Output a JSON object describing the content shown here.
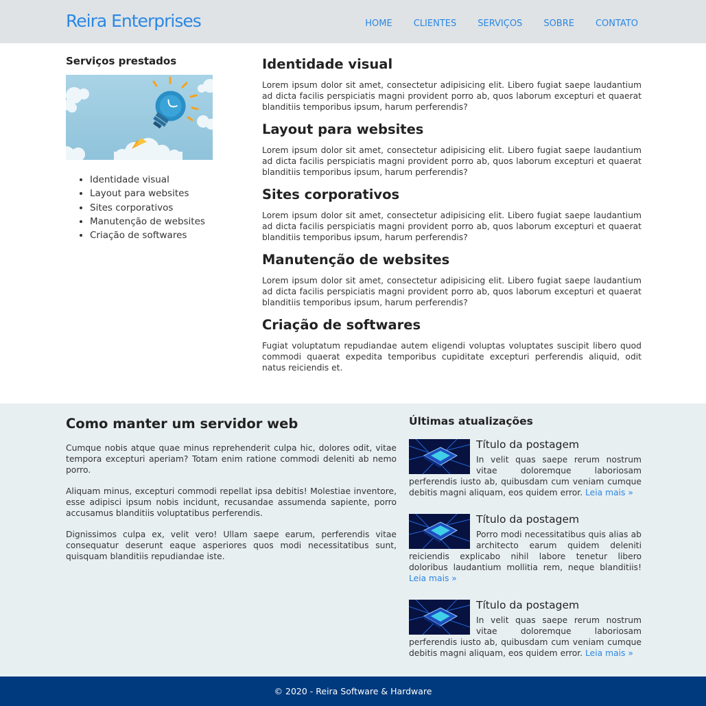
{
  "header": {
    "brand": "Reira Enterprises",
    "nav": [
      "HOME",
      "CLIENTES",
      "SERVIÇOS",
      "SOBRE",
      "CONTATO"
    ]
  },
  "sidebar": {
    "title": "Serviços prestados",
    "items": [
      "Identidade visual",
      "Layout para websites",
      "Sites corporativos",
      "Manutenção de websites",
      "Criação de softwares"
    ]
  },
  "services": [
    {
      "title": "Identidade visual",
      "text": "Lorem ipsum dolor sit amet, consectetur adipisicing elit. Libero fugiat saepe laudantium ad dicta facilis perspiciatis magni provident porro ab, quos laborum excepturi et quaerat blanditiis temporibus ipsum, harum perferendis?"
    },
    {
      "title": "Layout para websites",
      "text": "Lorem ipsum dolor sit amet, consectetur adipisicing elit. Libero fugiat saepe laudantium ad dicta facilis perspiciatis magni provident porro ab, quos laborum excepturi et quaerat blanditiis temporibus ipsum, harum perferendis?"
    },
    {
      "title": "Sites corporativos",
      "text": "Lorem ipsum dolor sit amet, consectetur adipisicing elit. Libero fugiat saepe laudantium ad dicta facilis perspiciatis magni provident porro ab, quos laborum excepturi et quaerat blanditiis temporibus ipsum, harum perferendis?"
    },
    {
      "title": "Manutenção de websites",
      "text": "Lorem ipsum dolor sit amet, consectetur adipisicing elit. Libero fugiat saepe laudantium ad dicta facilis perspiciatis magni provident porro ab, quos laborum excepturi et quaerat blanditiis temporibus ipsum, harum perferendis?"
    },
    {
      "title": "Criação de softwares",
      "text": "Fugiat voluptatum repudiandae autem eligendi voluptas voluptates suscipit libero quod commodi quaerat expedita temporibus cupiditate excepturi perferendis aliquid, odit natus reiciendis et."
    }
  ],
  "article": {
    "title": "Como manter um servidor web",
    "paragraphs": [
      "Cumque nobis atque quae minus reprehenderit culpa hic, dolores odit, vitae tempora excepturi aperiam? Totam enim ratione commodi deleniti ab nemo porro.",
      "Aliquam minus, excepturi commodi repellat ipsa debitis! Molestiae inventore, esse adipisci ipsum nobis incidunt, recusandae assumenda sapiente, porro accusamus blanditiis voluptatibus perferendis.",
      "Dignissimos culpa ex, velit vero! Ullam saepe earum, perferendis vitae consequatur deserunt eaque asperiores quos modi necessitatibus sunt, quisquam blanditiis repudiandae iste."
    ]
  },
  "updates": {
    "title": "Últimas atualizações",
    "posts": [
      {
        "title": "Título da postagem",
        "text": "In velit quas saepe rerum nostrum vitae doloremque laboriosam perferendis iusto ab, quibusdam cum veniam cumque debitis magni aliquam, eos quidem error.",
        "link": "Leia mais »"
      },
      {
        "title": "Título da postagem",
        "text": "Porro modi necessitatibus quis alias ab architecto earum quidem deleniti reiciendis explicabo nihil labore tenetur libero doloribus laudantium mollitia rem, neque blanditiis!",
        "link": "Leia mais »"
      },
      {
        "title": "Título da postagem",
        "text": "In velit quas saepe rerum nostrum vitae doloremque laboriosam perferendis iusto ab, quibusdam cum veniam cumque debitis magni aliquam, eos quidem error.",
        "link": "Leia mais »"
      }
    ]
  },
  "footer": {
    "text": "© 2020 - Reira Software & Hardware"
  },
  "colors": {
    "accent": "#2b87e3",
    "footer_bg": "#003a7e",
    "header_bg": "#dfe3e6",
    "lower_bg": "#e8eff1"
  }
}
